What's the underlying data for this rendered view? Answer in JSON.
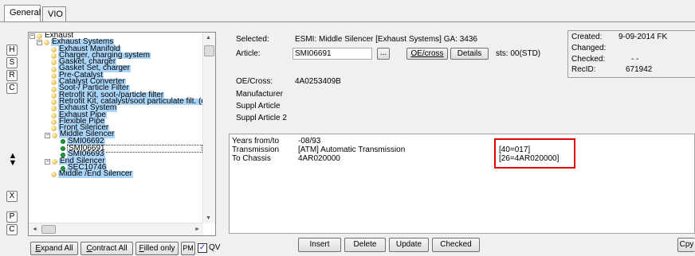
{
  "tabs": [
    "General",
    "VIO"
  ],
  "side_buttons_top": [
    "H",
    "S",
    "R",
    "C"
  ],
  "side_buttons_bottom": [
    "X",
    "P",
    "C"
  ],
  "tree": {
    "root": "Exhaust",
    "items": [
      "Exhaust Systems",
      "Exhaust Manifold",
      "Charger, charging system",
      "Gasket, charger",
      "Gasket Set, charger",
      "Pre-Catalyst",
      "Catalyst Converter",
      "Soot-/ Particle Filter",
      "Retrofit Kit, soot-/particle filter",
      "Retrofit Kit, catalyst/soot particulate filt. (co",
      "Exhaust System",
      "Exhaust Pipe",
      "Flexible Pipe",
      "Front Silencer",
      "Middle Silencer",
      "SMI06692",
      "SMI06691",
      "SMI06693",
      "End Silencer",
      "SEC10746",
      "Middle /End Silencer"
    ]
  },
  "bottom_left": {
    "expand_all": "Expand All",
    "contract_all": "Contract All",
    "filled_only": "Filled only",
    "pm": "PM",
    "qv": "QV",
    "qv_checked": "✓"
  },
  "info": {
    "selected_label": "Selected:",
    "selected_value": "ESMI: Middle Silencer [Exhaust Systems] GA: 3436",
    "article_label": "Article:",
    "article_value": "SMI06691",
    "browse_btn": "...",
    "oe_cross_btn": "OE/cross",
    "details_btn": "Details",
    "sts": "sts: 00(STD)",
    "oecross_label": "OE/Cross:",
    "oecross_value": "4A0253409B",
    "manufacturer_label": "Manufacturer",
    "suppl_article_label": "Suppl Article",
    "suppl_article2_label": "Suppl Article 2"
  },
  "meta": {
    "created_label": "Created:",
    "created_value": "9-09-2014 FK",
    "changed_label": "Changed:",
    "checked_label": "Checked:",
    "checked_value": "- -",
    "recid_label": "RecID:",
    "recid_value": "671942"
  },
  "details": {
    "years_label": "Years from/to",
    "years_value": "-08/93",
    "transmission_label": "Transmission",
    "transmission_value": "[ATM] Automatic Transmission",
    "chassis_label": "To Chassis",
    "chassis_value": "4AR020000",
    "code1": "[40=017]",
    "code2": "[26=4AR020000]"
  },
  "actions": {
    "insert": "Insert",
    "delete": "Delete",
    "update": "Update",
    "checked": "Checked",
    "copy": "Cpy"
  }
}
